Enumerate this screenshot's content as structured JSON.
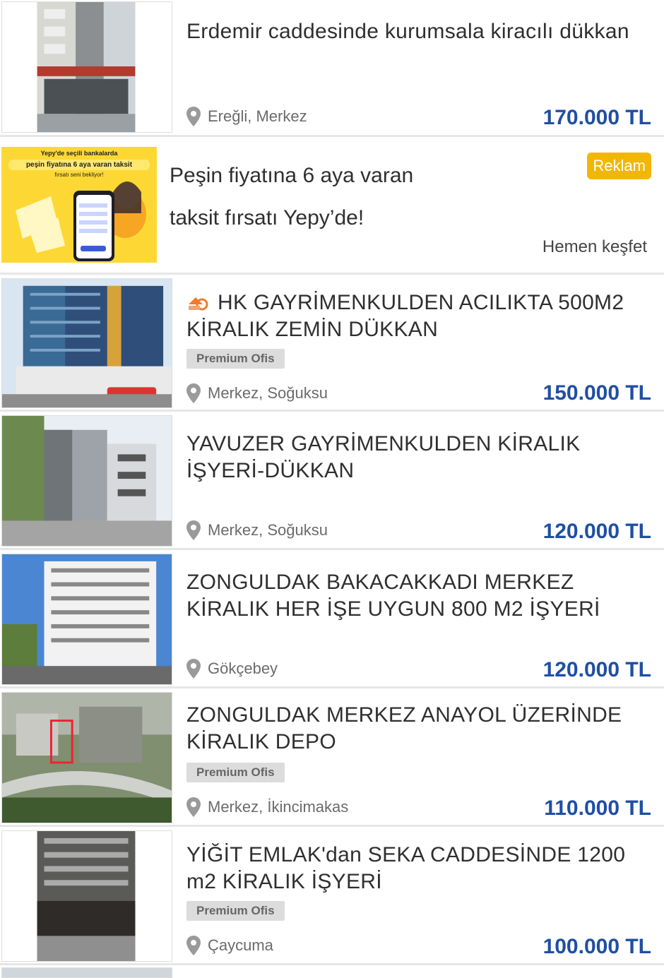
{
  "listings": [
    {
      "title": "Erdemir caddesinde kurumsala kiracılı dükkan",
      "location": "Ereğli, Merkez",
      "price": "170.000 TL",
      "badge": ""
    },
    {
      "title": "HK GAYRİMENKULDEN ACILIKTA 500M2 KİRALIK ZEMİN DÜKKAN",
      "location": "Merkez, Soğuksu",
      "price": "150.000 TL",
      "badge": "Premium Ofis"
    },
    {
      "title": "YAVUZER GAYRİMENKULDEN KİRALIK İŞYERİ-DÜKKAN",
      "location": "Merkez, Soğuksu",
      "price": "120.000 TL",
      "badge": ""
    },
    {
      "title": "ZONGULDAK BAKACAKKADI MERKEZ KİRALIK HER İŞE UYGUN 800 M2 İŞYERİ",
      "location": "Gökçebey",
      "price": "120.000 TL",
      "badge": ""
    },
    {
      "title": "ZONGULDAK MERKEZ ANAYOL ÜZERİNDE KİRALIK DEPO",
      "location": "Merkez, İkincimakas",
      "price": "110.000 TL",
      "badge": "Premium Ofis"
    },
    {
      "title": "YİĞİT EMLAK'dan SEKA CADDESİNDE 1200 m2 KİRALIK İŞYERİ",
      "location": "Çaycuma",
      "price": "100.000 TL",
      "badge": "Premium Ofis"
    }
  ],
  "ad": {
    "line1": "Peşin fiyatına 6 aya varan",
    "line2": "taksit fırsatı Yepy’de!",
    "label": "Reklam",
    "cta": "Hemen keşfet",
    "banner_top": "Yepy'de seçili bankalarda",
    "banner_main": "peşin fiyatına 6 aya varan taksit",
    "banner_sub": "fırsatı seni bekliyor!"
  },
  "colors": {
    "price": "#1f4fa3",
    "ad_label": "#f2b705",
    "ad_bg": "#fdd835"
  }
}
